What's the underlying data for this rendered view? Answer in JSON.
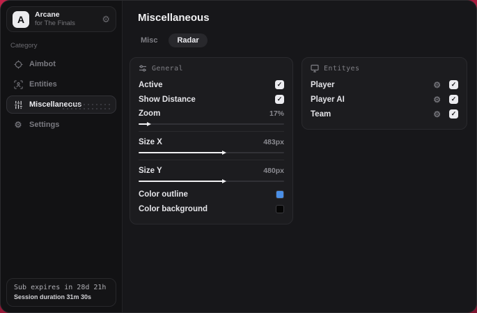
{
  "app": {
    "logo_letter": "A",
    "name": "Arcane",
    "subtitle": "for The Finals"
  },
  "icons": {
    "gear": "⚙",
    "check": "✓"
  },
  "sidebar": {
    "category_label": "Category",
    "items": [
      {
        "label": "Aimbot",
        "active": false
      },
      {
        "label": "Entities",
        "active": false
      },
      {
        "label": "Miscellaneous",
        "active": true
      },
      {
        "label": "Settings",
        "active": false
      }
    ],
    "footer": {
      "sub_line": "Sub expires in 28d 21h",
      "session_line": "Session duration 31m 30s"
    }
  },
  "main": {
    "title": "Miscellaneous",
    "tabs": [
      {
        "label": "Misc",
        "active": false
      },
      {
        "label": "Radar",
        "active": true
      }
    ],
    "panels": {
      "general": {
        "title": "General",
        "rows": {
          "active": {
            "label": "Active",
            "checked": true
          },
          "show_distance": {
            "label": "Show Distance",
            "checked": true
          },
          "zoom": {
            "label": "Zoom",
            "value": "17%",
            "fill_style": "width:6%"
          },
          "size_x": {
            "label": "Size X",
            "value": "483px",
            "fill_style": "width:58%"
          },
          "size_y": {
            "label": "Size Y",
            "value": "480px",
            "fill_style": "width:58%"
          },
          "color_outline": {
            "label": "Color outline",
            "color": "#4a8fe7",
            "swatch_style": "background:#4a8fe7"
          },
          "color_background": {
            "label": "Color background",
            "color": "#050505",
            "swatch_style": "background:#050505"
          }
        }
      },
      "entities": {
        "title": "Entityes",
        "rows": [
          {
            "label": "Player",
            "checked": true
          },
          {
            "label": "Player AI",
            "checked": true
          },
          {
            "label": "Team",
            "checked": true
          }
        ]
      }
    }
  },
  "colors": {
    "accent_red": "#b01c42",
    "outline_swatch": "#4a8fe7",
    "background_swatch": "#050505"
  }
}
